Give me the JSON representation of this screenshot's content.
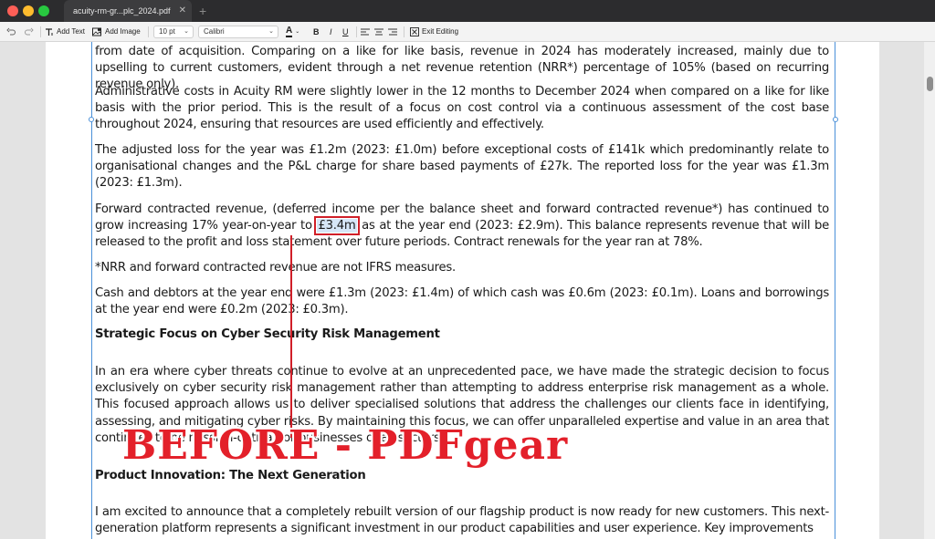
{
  "window": {
    "tab_title": "acuity-rm-gr...plc_2024.pdf",
    "tab_close": "✕",
    "new_tab": "+"
  },
  "toolbar": {
    "undo_icon": "undo-icon",
    "redo_icon": "redo-icon",
    "add_text": "Add Text",
    "add_image": "Add Image",
    "font_size": "10 pt",
    "font_family": "Calibri",
    "text_color_label": "A",
    "bold": "B",
    "italic": "I",
    "underline": "U",
    "exit_editing": "Exit Editing"
  },
  "document": {
    "p1": "from date of acquisition. Comparing on a like for like basis, revenue in 2024 has moderately increased, mainly due to upselling to current customers, evident through a net revenue retention (NRR*) percentage of 105% (based on recurring revenue only).",
    "p2": "Administrative costs in Acuity RM were slightly lower in the 12 months to December 2024 when compared on a like for like basis with the prior period. This is the result of a focus on cost control via a continuous assessment of the cost base throughout 2024, ensuring that resources are used efficiently and effectively.",
    "p3": "The adjusted loss for the year was £1.2m (2023: £1.0m) before exceptional costs of £141k which predominantly relate to organisational changes and the P&L charge for share based payments of £27k. The reported loss for the year was £1.3m (2023: £1.3m).",
    "p4_before": "Forward contracted revenue, (deferred income per the balance sheet and forward contracted revenue*) has continued to grow increasing 17% year-on-year to ",
    "p4_highlight": "£3.4m",
    "p4_after": " as at the year end (2023: £2.9m). This balance represents revenue that will be released to the profit and loss statement over future periods. Contract renewals for the year ran at 78%.",
    "p5": "*NRR and forward contracted revenue are not IFRS measures.",
    "p6": "Cash and debtors at the year end were £1.3m (2023: £1.4m) of which cash was £0.6m (2023: £0.1m). Loans and borrowings at the year end were £0.2m (2023: £0.3m).",
    "h1": "Strategic Focus on Cyber Security Risk Management",
    "p7": "In an era where cyber threats continue to evolve at an unprecedented pace, we have made the strategic decision to focus exclusively on cyber security risk management rather than attempting to address enterprise risk management as a whole. This focused approach allows us to deliver specialised solutions that address the challenges our clients face in identifying, assessing, and mitigating cyber risks. By maintaining this focus, we can offer unparalleled expertise and value in an area that continues to be mission-critical for businesses of all sectors.",
    "h2": "Product Innovation: The Next Generation",
    "p8": "I am excited to announce that a completely rebuilt version of our flagship product is now ready for new customers. This next-generation platform represents a significant investment in our product capabilities and user experience. Key improvements"
  },
  "annotation": {
    "overlay_text": "BEFORE - PDFgear",
    "color": "#e3202a"
  },
  "colors": {
    "selection": "#4a90d9",
    "highlight_box": "#d01f28"
  }
}
